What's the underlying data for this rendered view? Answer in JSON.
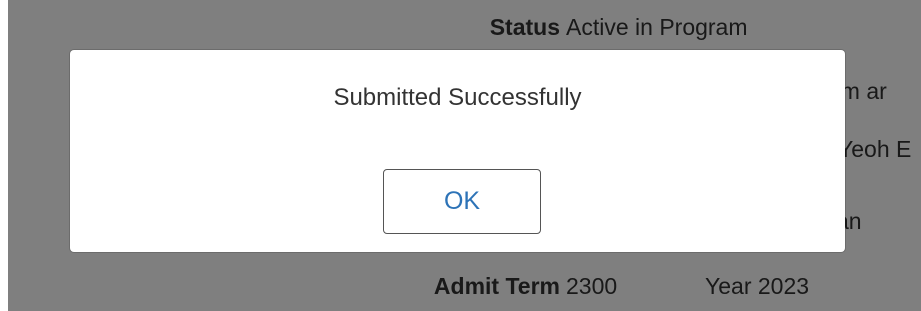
{
  "background": {
    "status_label": "Status",
    "status_value": "Active in Program",
    "row1_value_partial": "om ar",
    "row2_value_partial": "Yeoh E",
    "row3_value_partial": "an",
    "admit_term_label": "Admit Term",
    "admit_term_value": "2300",
    "admit_term_year": "Year 2023"
  },
  "dialog": {
    "message": "Submitted Successfully",
    "ok_label": "OK"
  },
  "colors": {
    "overlay": "#7f7f7f",
    "button_text": "#2d73b7"
  }
}
